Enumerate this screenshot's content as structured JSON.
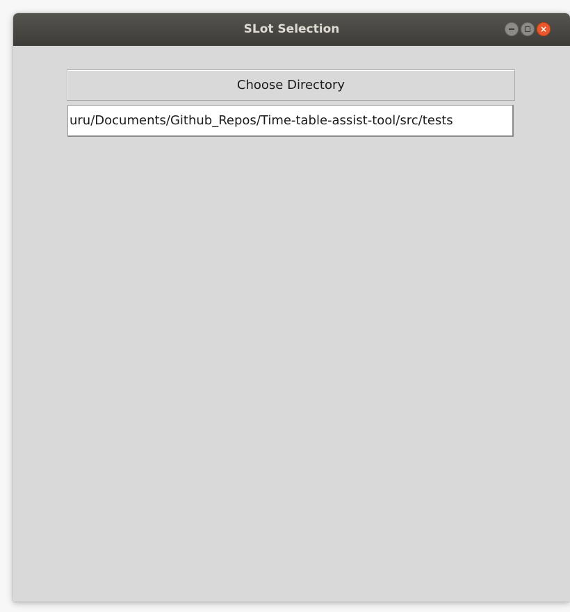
{
  "window": {
    "title": "SLot Selection",
    "controls": {
      "minimize_icon": "minimize-icon",
      "maximize_icon": "maximize-icon",
      "close_icon": "close-icon",
      "close_glyph": "×"
    }
  },
  "main": {
    "choose_button_label": "Choose Directory",
    "path_text": "uru/Documents/Github_Repos/Time-table-assist-tool/src/tests"
  },
  "colors": {
    "titlebar": "#3d3c38",
    "window_bg": "#d9d9d9",
    "close_button": "#e9572c"
  }
}
